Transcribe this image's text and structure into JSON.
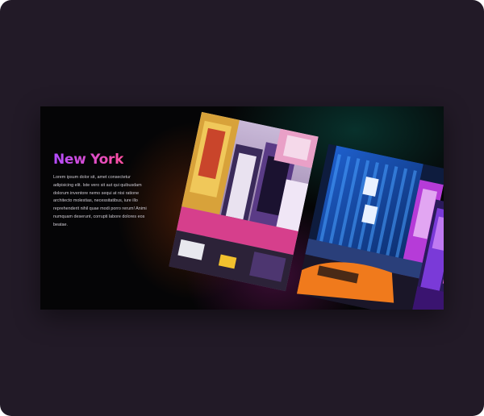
{
  "slide": {
    "title": "New York",
    "body": "Lorem ipsum dolor sit, amet consectetur adipisicing elit. Iste vero sit aut qui quibusdam dolorum inventore nemo sequi at nisi ratione architecto molestias, necessitatibus, iure illo reprehenderit nihil quae modi porro rerum! Animi numquam deserunt, corrupti labore dolores eos beatae."
  },
  "photos": [
    {
      "subject": "times-square-billboards"
    },
    {
      "subject": "renaissance-hotel-street"
    },
    {
      "subject": "neon-storefront"
    }
  ],
  "colors": {
    "frame_bg": "#221a27",
    "card_bg": "#050506",
    "title_gradient_start": "#b34bff",
    "title_gradient_end": "#ff4fa0",
    "body_text": "#cfcbd3"
  }
}
